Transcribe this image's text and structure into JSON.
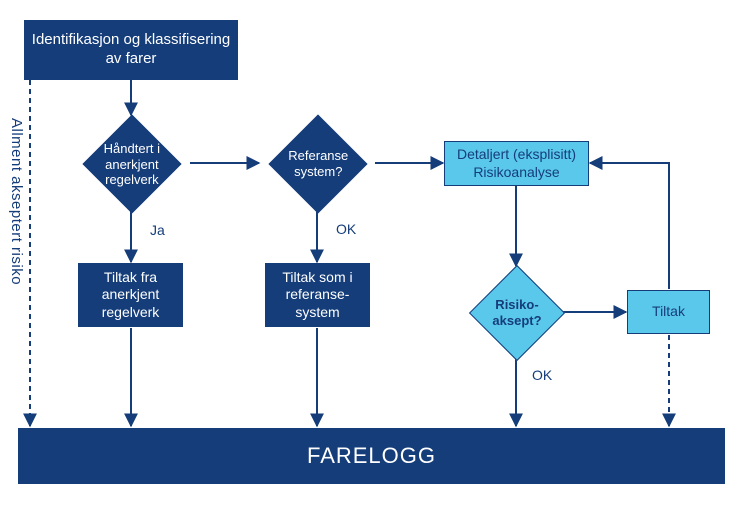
{
  "colors": {
    "dark": "#153d7a",
    "light": "#5ac8eb"
  },
  "nodes": {
    "start": "Identifikasjon og\nklassifisering av farer",
    "q_regelverk": "Håndtert i\nanerkjent\nregelverk",
    "q_referanse": "Referanse\nsystem?",
    "detaljert": "Detaljert  (eksplisitt)\nRisikoanalyse",
    "tiltak_regelverk": "Tiltak fra\nanerkjent\nregelverk",
    "tiltak_referanse": "Tiltak som i\nreferanse-\nsystem",
    "q_aksept": "Risiko-\naksept?",
    "tiltak": "Tiltak",
    "farelogg": "FARELOGG"
  },
  "labels": {
    "ja": "Ja",
    "ok1": "OK",
    "ok2": "OK"
  },
  "side_text": "Allment akseptert risiko"
}
